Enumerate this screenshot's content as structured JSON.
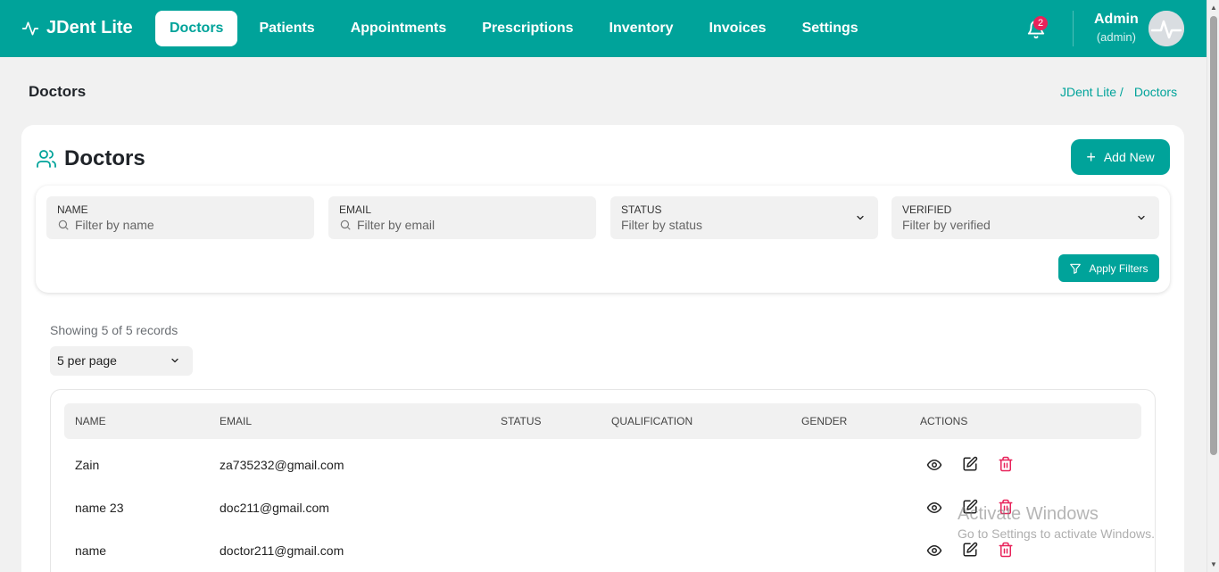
{
  "nav": {
    "brand": "JDent Lite",
    "links": [
      "Doctors",
      "Patients",
      "Appointments",
      "Prescriptions",
      "Inventory",
      "Invoices",
      "Settings"
    ],
    "active": "Doctors",
    "notifications": "2",
    "user_name": "Admin",
    "user_role": "(admin)"
  },
  "header": {
    "title": "Doctors",
    "breadcrumb": [
      "JDent Lite /",
      "Doctors"
    ]
  },
  "card": {
    "title": "Doctors",
    "add_label": "Add New"
  },
  "filters": [
    {
      "label": "NAME",
      "placeholder": "Filter by name",
      "type": "text"
    },
    {
      "label": "EMAIL",
      "placeholder": "Filter by email",
      "type": "text"
    },
    {
      "label": "STATUS",
      "placeholder": "Filter by status",
      "type": "select"
    },
    {
      "label": "VERIFIED",
      "placeholder": "Filter by verified",
      "type": "select"
    }
  ],
  "apply_label": "Apply Filters",
  "records_text": "Showing 5 of 5 records",
  "per_page": "5 per page",
  "table": {
    "headers": [
      "NAME",
      "EMAIL",
      "STATUS",
      "QUALIFICATION",
      "GENDER",
      "ACTIONS"
    ],
    "rows": [
      {
        "name": "Zain",
        "email": "za735232@gmail.com",
        "status": "",
        "qualification": "",
        "gender": ""
      },
      {
        "name": "name 23",
        "email": "doc211@gmail.com",
        "status": "",
        "qualification": "",
        "gender": ""
      },
      {
        "name": "name",
        "email": "doctor211@gmail.com",
        "status": "",
        "qualification": "",
        "gender": ""
      }
    ]
  },
  "watermark": {
    "line1": "Activate Windows",
    "line2": "Go to Settings to activate Windows."
  },
  "colors": {
    "primary": "#00a39a",
    "danger": "#e8225a",
    "background": "#f1f1f1"
  }
}
